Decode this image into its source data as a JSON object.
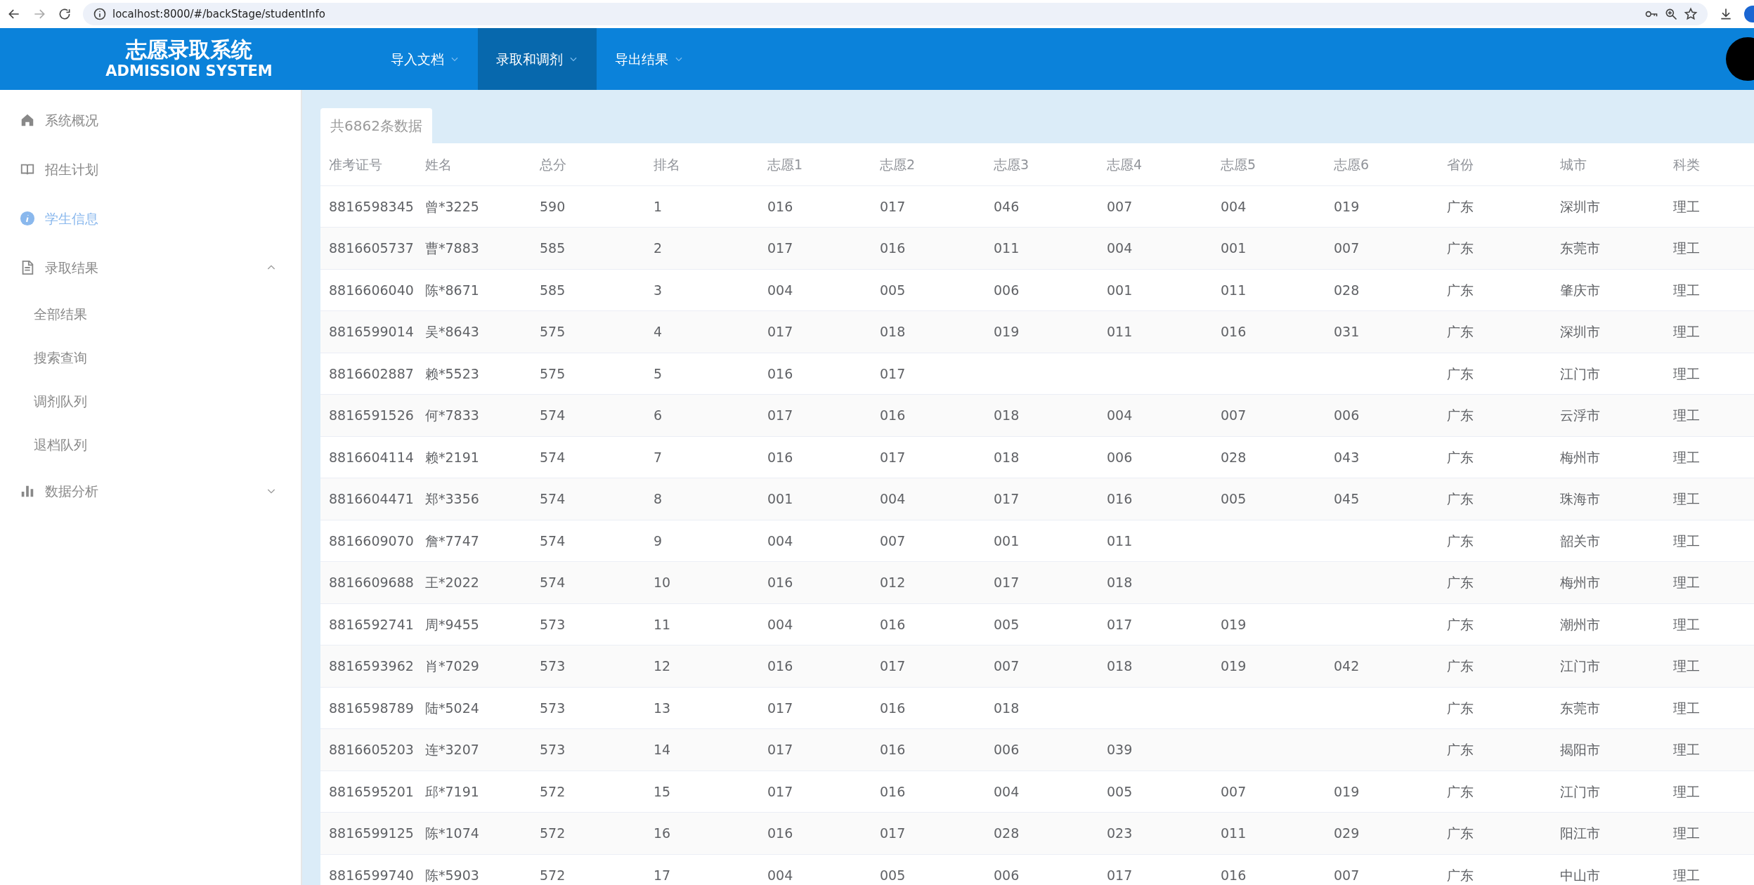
{
  "browser": {
    "url": "localhost:8000/#/backStage/studentInfo"
  },
  "header": {
    "title": "志愿录取系统",
    "subtitle": "ADMISSION SYSTEM",
    "menu": [
      {
        "label": "导入文档",
        "selected": false
      },
      {
        "label": "录取和调剂",
        "selected": true
      },
      {
        "label": "导出结果",
        "selected": false
      }
    ]
  },
  "sidebar": {
    "items": [
      {
        "label": "系统概况",
        "selected": false
      },
      {
        "label": "招生计划",
        "selected": false
      },
      {
        "label": "学生信息",
        "selected": true
      },
      {
        "label": "录取结果",
        "selected": false,
        "expanded": true,
        "children": [
          {
            "label": "全部结果"
          },
          {
            "label": "搜索查询"
          },
          {
            "label": "调剂队列"
          },
          {
            "label": "退档队列"
          }
        ]
      },
      {
        "label": "数据分析",
        "selected": false,
        "expanded": false
      }
    ]
  },
  "tab": {
    "label": "共6862条数据"
  },
  "table": {
    "columns": [
      "准考证号",
      "姓名",
      "总分",
      "排名",
      "志愿1",
      "志愿2",
      "志愿3",
      "志愿4",
      "志愿5",
      "志愿6",
      "省份",
      "城市",
      "科类"
    ],
    "rows": [
      {
        "id": "8816598345",
        "name": "曾*3225",
        "score": "590",
        "rank": "1",
        "choices": [
          "016",
          "017",
          "046",
          "007",
          "004",
          "019"
        ],
        "province": "广东",
        "city": "深圳市",
        "type": "理工"
      },
      {
        "id": "8816605737",
        "name": "曹*7883",
        "score": "585",
        "rank": "2",
        "choices": [
          "017",
          "016",
          "011",
          "004",
          "001",
          "007"
        ],
        "province": "广东",
        "city": "东莞市",
        "type": "理工"
      },
      {
        "id": "8816606040",
        "name": "陈*8671",
        "score": "585",
        "rank": "3",
        "choices": [
          "004",
          "005",
          "006",
          "001",
          "011",
          "028"
        ],
        "province": "广东",
        "city": "肇庆市",
        "type": "理工"
      },
      {
        "id": "8816599014",
        "name": "吴*8643",
        "score": "575",
        "rank": "4",
        "choices": [
          "017",
          "018",
          "019",
          "011",
          "016",
          "031"
        ],
        "province": "广东",
        "city": "深圳市",
        "type": "理工"
      },
      {
        "id": "8816602887",
        "name": "赖*5523",
        "score": "575",
        "rank": "5",
        "choices": [
          "016",
          "017"
        ],
        "province": "广东",
        "city": "江门市",
        "type": "理工"
      },
      {
        "id": "8816591526",
        "name": "何*7833",
        "score": "574",
        "rank": "6",
        "choices": [
          "017",
          "016",
          "018",
          "004",
          "007",
          "006"
        ],
        "province": "广东",
        "city": "云浮市",
        "type": "理工"
      },
      {
        "id": "8816604114",
        "name": "赖*2191",
        "score": "574",
        "rank": "7",
        "choices": [
          "016",
          "017",
          "018",
          "006",
          "028",
          "043"
        ],
        "province": "广东",
        "city": "梅州市",
        "type": "理工"
      },
      {
        "id": "8816604471",
        "name": "郑*3356",
        "score": "574",
        "rank": "8",
        "choices": [
          "001",
          "004",
          "017",
          "016",
          "005",
          "045"
        ],
        "province": "广东",
        "city": "珠海市",
        "type": "理工"
      },
      {
        "id": "8816609070",
        "name": "詹*7747",
        "score": "574",
        "rank": "9",
        "choices": [
          "004",
          "007",
          "001",
          "011"
        ],
        "province": "广东",
        "city": "韶关市",
        "type": "理工"
      },
      {
        "id": "8816609688",
        "name": "王*2022",
        "score": "574",
        "rank": "10",
        "choices": [
          "016",
          "012",
          "017",
          "018"
        ],
        "province": "广东",
        "city": "梅州市",
        "type": "理工"
      },
      {
        "id": "8816592741",
        "name": "周*9455",
        "score": "573",
        "rank": "11",
        "choices": [
          "004",
          "016",
          "005",
          "017",
          "019"
        ],
        "province": "广东",
        "city": "潮州市",
        "type": "理工"
      },
      {
        "id": "8816593962",
        "name": "肖*7029",
        "score": "573",
        "rank": "12",
        "choices": [
          "016",
          "017",
          "007",
          "018",
          "019",
          "042"
        ],
        "province": "广东",
        "city": "江门市",
        "type": "理工"
      },
      {
        "id": "8816598789",
        "name": "陆*5024",
        "score": "573",
        "rank": "13",
        "choices": [
          "017",
          "016",
          "018"
        ],
        "province": "广东",
        "city": "东莞市",
        "type": "理工"
      },
      {
        "id": "8816605203",
        "name": "连*3207",
        "score": "573",
        "rank": "14",
        "choices": [
          "017",
          "016",
          "006",
          "039"
        ],
        "province": "广东",
        "city": "揭阳市",
        "type": "理工"
      },
      {
        "id": "8816595201",
        "name": "邱*7191",
        "score": "572",
        "rank": "15",
        "choices": [
          "017",
          "016",
          "004",
          "005",
          "007",
          "019"
        ],
        "province": "广东",
        "city": "江门市",
        "type": "理工"
      },
      {
        "id": "8816599125",
        "name": "陈*1074",
        "score": "572",
        "rank": "16",
        "choices": [
          "016",
          "017",
          "028",
          "023",
          "011",
          "029"
        ],
        "province": "广东",
        "city": "阳江市",
        "type": "理工"
      },
      {
        "id": "8816599740",
        "name": "陈*5903",
        "score": "572",
        "rank": "17",
        "choices": [
          "004",
          "005",
          "006",
          "017",
          "016",
          "007"
        ],
        "province": "广东",
        "city": "中山市",
        "type": "理工"
      }
    ]
  }
}
